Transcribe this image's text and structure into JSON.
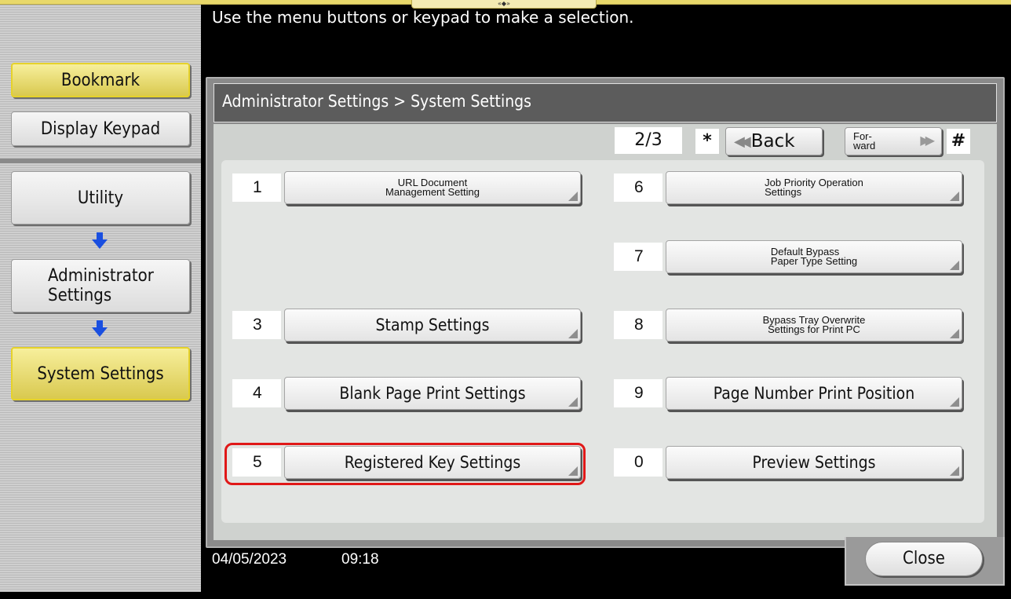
{
  "message": "Use the menu buttons or keypad to make a selection.",
  "top_handle_glyph": "«◆»",
  "sidebar": {
    "bookmark": "Bookmark",
    "display_keypad": "Display Keypad",
    "utility": "Utility",
    "administrator_settings": "Administrator Settings",
    "system_settings": "System Settings"
  },
  "breadcrumb": "Administrator Settings > System Settings",
  "pagination": {
    "page_indicator": "2/3",
    "star_key": "*",
    "hash_key": "#",
    "back_label": "Back",
    "forward_label_line1": "For-",
    "forward_label_line2": "ward"
  },
  "menu": {
    "item1": {
      "num": "1",
      "label_line1": "URL Document",
      "label_line2": "Management Setting"
    },
    "item3": {
      "num": "3",
      "label": "Stamp Settings"
    },
    "item4": {
      "num": "4",
      "label": "Blank Page Print Settings"
    },
    "item5": {
      "num": "5",
      "label": "Registered Key Settings"
    },
    "item6": {
      "num": "6",
      "label_line1": "Job Priority Operation",
      "label_line2": "Settings"
    },
    "item7": {
      "num": "7",
      "label_line1": "Default Bypass",
      "label_line2": "Paper Type Setting"
    },
    "item8": {
      "num": "8",
      "label_line1": "Bypass Tray Overwrite",
      "label_line2": "Settings for Print PC"
    },
    "item9": {
      "num": "9",
      "label": "Page Number Print Position"
    },
    "item0": {
      "num": "0",
      "label": "Preview Settings"
    }
  },
  "footer": {
    "date": "04/05/2023",
    "time": "09:18",
    "close_label": "Close"
  },
  "colors": {
    "highlight": "#e01818",
    "bookmark_yellow": "#e6d22a",
    "arrow_blue": "#1a4fe0"
  }
}
